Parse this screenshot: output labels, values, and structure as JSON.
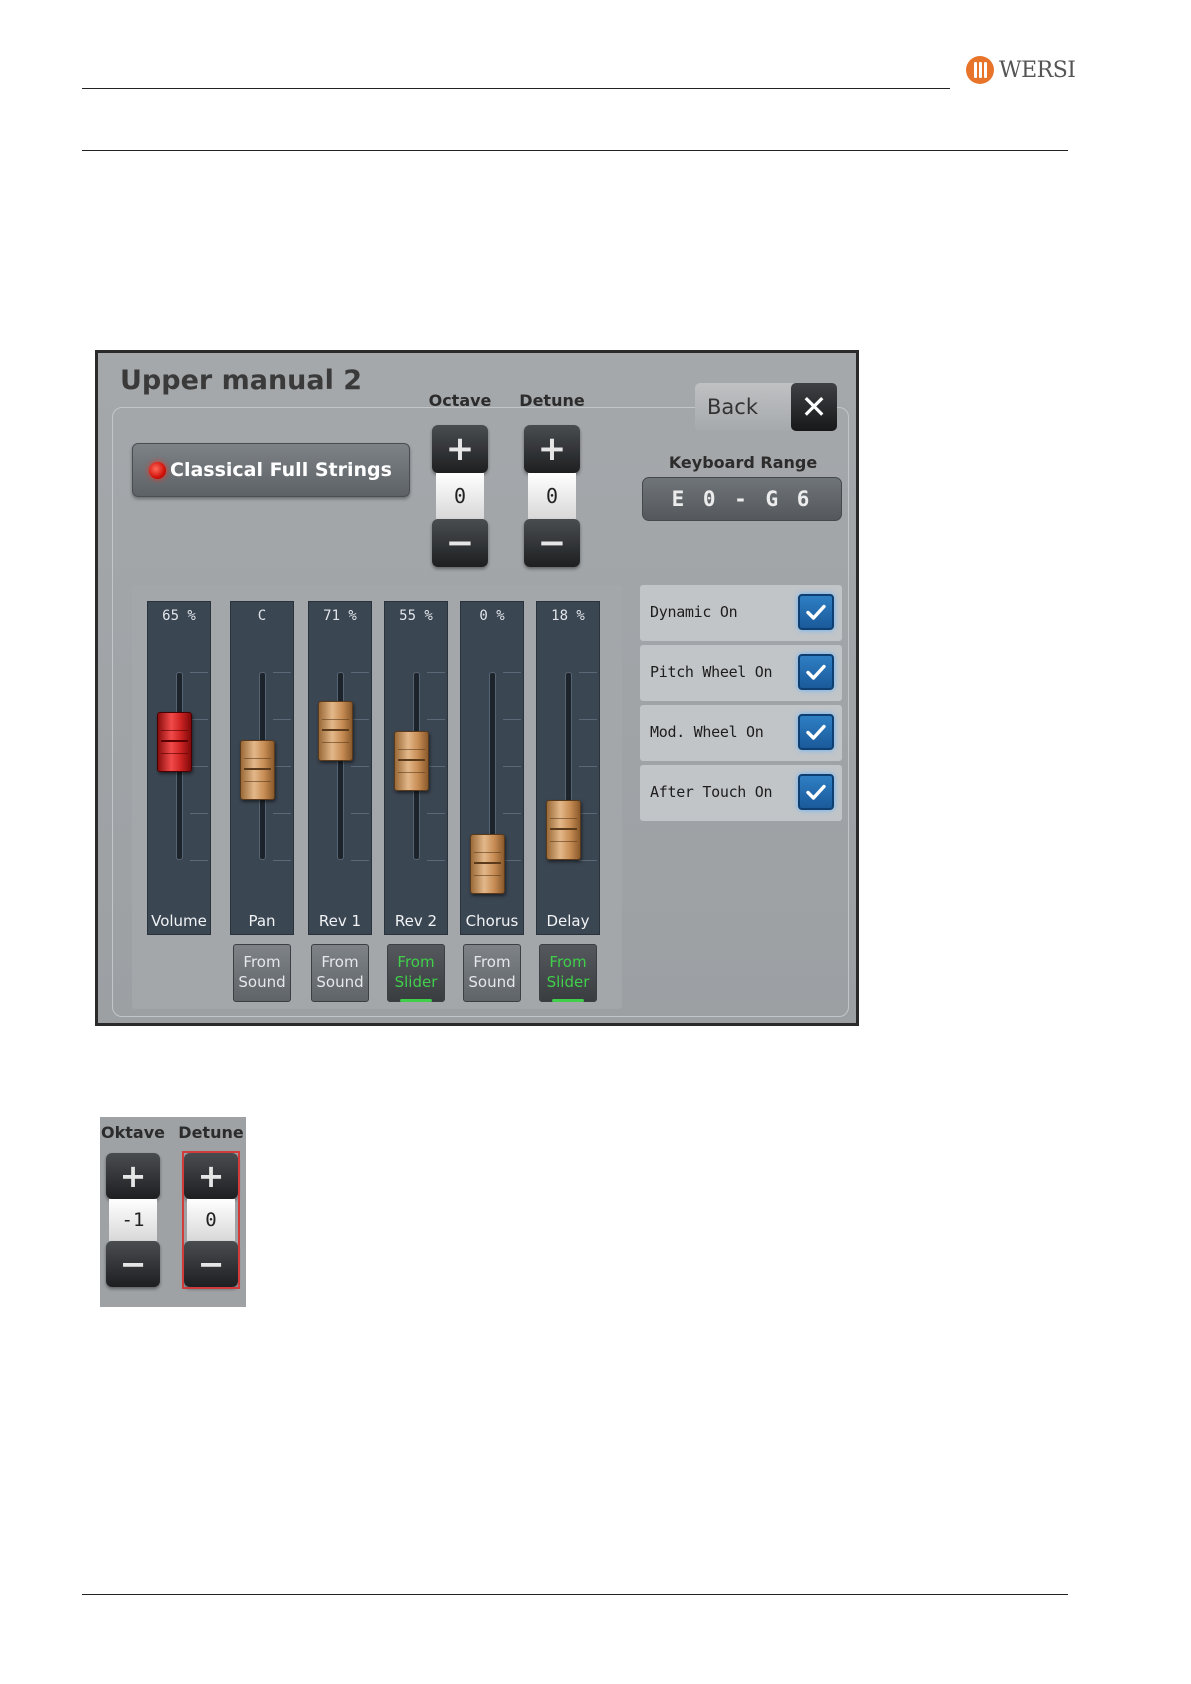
{
  "header": {
    "logo_text": "WERSI"
  },
  "panel": {
    "title": "Upper manual 2",
    "sound": {
      "name": "Classical Full Strings",
      "led_color": "#e01a0f"
    },
    "octave": {
      "label": "Octave",
      "plus": "+",
      "value": "0",
      "minus": "−"
    },
    "detune": {
      "label": "Detune",
      "plus": "+",
      "value": "0",
      "minus": "−"
    },
    "back": {
      "label": "Back",
      "close_glyph": "✕"
    },
    "keyboard_range": {
      "label": "Keyboard Range",
      "value": "E 0 - G 6"
    },
    "channels": [
      {
        "name": "Volume",
        "value": "65 %",
        "level": 0.65,
        "source": ""
      },
      {
        "name": "Pan",
        "value": "C",
        "level": 0.5,
        "source": "From\nSound",
        "source_type": "sound"
      },
      {
        "name": "Rev 1",
        "value": "71 %",
        "level": 0.71,
        "source": "From\nSound",
        "source_type": "sound"
      },
      {
        "name": "Rev 2",
        "value": "55 %",
        "level": 0.55,
        "source": "From\nSlider",
        "source_type": "slider"
      },
      {
        "name": "Chorus",
        "value": "0 %",
        "level": 0.0,
        "source": "From\nSound",
        "source_type": "sound"
      },
      {
        "name": "Delay",
        "value": "18 %",
        "level": 0.18,
        "source": "From\nSlider",
        "source_type": "slider"
      }
    ],
    "options": [
      {
        "label": "Dynamic On",
        "checked": true
      },
      {
        "label": "Pitch Wheel On",
        "checked": true
      },
      {
        "label": "Mod. Wheel On",
        "checked": true
      },
      {
        "label": "After Touch On",
        "checked": true
      }
    ],
    "colors": {
      "accent_checkbox": "#2f7fc4",
      "slider_source": "#3fcf4a",
      "fader": "#c88d55",
      "volume_fader": "#cc2222"
    }
  },
  "inset": {
    "oktave": {
      "label": "Oktave",
      "plus": "+",
      "value": "-1",
      "minus": "−"
    },
    "detune": {
      "label": "Detune",
      "plus": "+",
      "value": "0",
      "minus": "−"
    }
  }
}
